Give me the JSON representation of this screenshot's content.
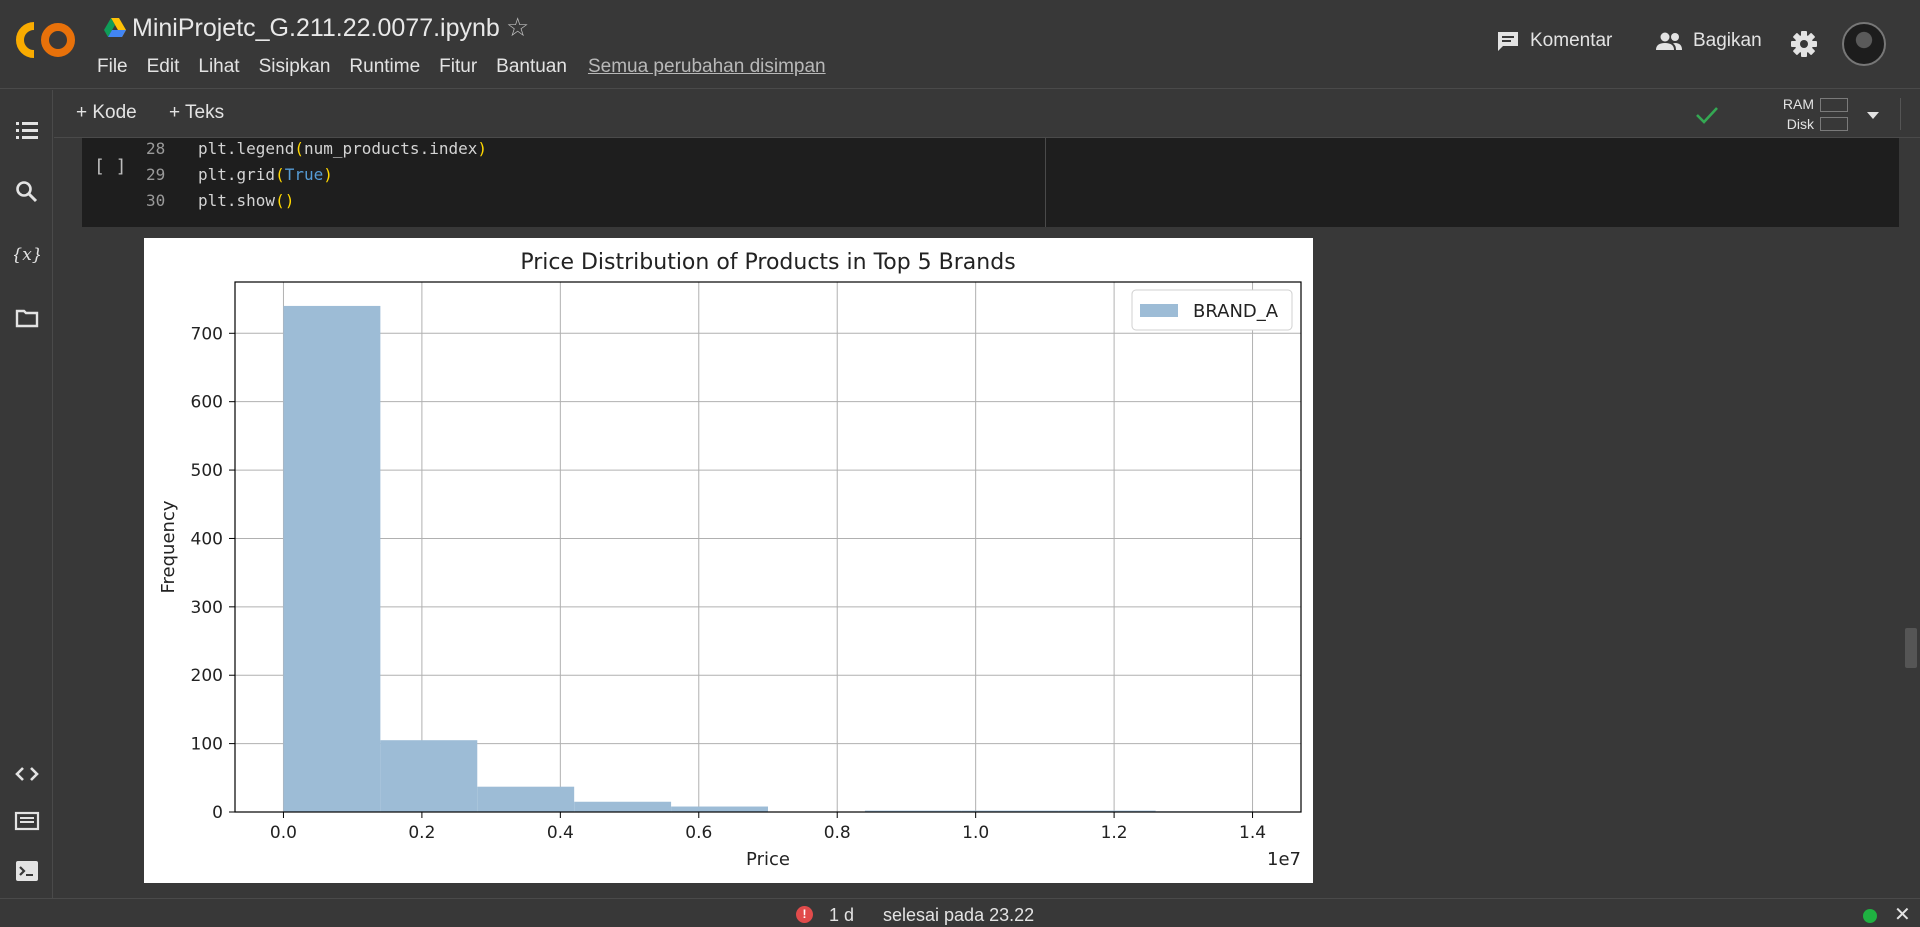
{
  "header": {
    "notebook_title": "MiniProjetc_G.211.22.0077.ipynb",
    "menu": [
      "File",
      "Edit",
      "Lihat",
      "Sisipkan",
      "Runtime",
      "Fitur",
      "Bantuan"
    ],
    "save_status": "Semua perubahan disimpan",
    "comment_label": "Komentar",
    "share_label": "Bagikan",
    "icons": [
      "colab-logo",
      "drive-icon",
      "star-icon",
      "comment-icon",
      "people-icon",
      "gear-icon",
      "avatar"
    ]
  },
  "toolbar": {
    "add_code": "+ Kode",
    "add_text": "+ Teks",
    "ram_label": "RAM",
    "disk_label": "Disk"
  },
  "cell": {
    "run_indicator": "[ ]",
    "lines": [
      {
        "num": "28",
        "text": "plt.legend(num_products.index)"
      },
      {
        "num": "29",
        "text": "plt.grid(True)"
      },
      {
        "num": "30",
        "text": "plt.show()"
      }
    ]
  },
  "status": {
    "error_glyph": "!",
    "duration": "1 d",
    "completed": "selesai pada 23.22"
  },
  "colors": {
    "bar": "#9dbcd6",
    "background": "#383838",
    "cell_bg": "#1e1e1e",
    "status_ok": "#1fb141",
    "error": "#e14b4b"
  },
  "chart_data": {
    "type": "bar",
    "title": "Price Distribution of Products in Top 5 Brands",
    "xlabel": "Price",
    "ylabel": "Frequency",
    "x_offset_label": "1e7",
    "xlim": [
      -0.07,
      1.47
    ],
    "ylim": [
      0,
      775
    ],
    "grid": true,
    "legend_position": "top-right",
    "x_ticks": [
      0.0,
      0.2,
      0.4,
      0.6,
      0.8,
      1.0,
      1.2,
      1.4
    ],
    "x_tick_labels": [
      "0.0",
      "0.2",
      "0.4",
      "0.6",
      "0.8",
      "1.0",
      "1.2",
      "1.4"
    ],
    "y_ticks": [
      0,
      100,
      200,
      300,
      400,
      500,
      600,
      700
    ],
    "y_tick_labels": [
      "0",
      "100",
      "200",
      "300",
      "400",
      "500",
      "600",
      "700"
    ],
    "series": [
      {
        "name": "BRAND_A",
        "bin_edges": [
          0.0,
          0.14,
          0.28,
          0.42,
          0.56,
          0.7,
          0.84,
          0.98,
          1.12,
          1.26,
          1.4
        ],
        "values": [
          740,
          105,
          37,
          15,
          8,
          0,
          2,
          2,
          2,
          1
        ]
      }
    ]
  }
}
